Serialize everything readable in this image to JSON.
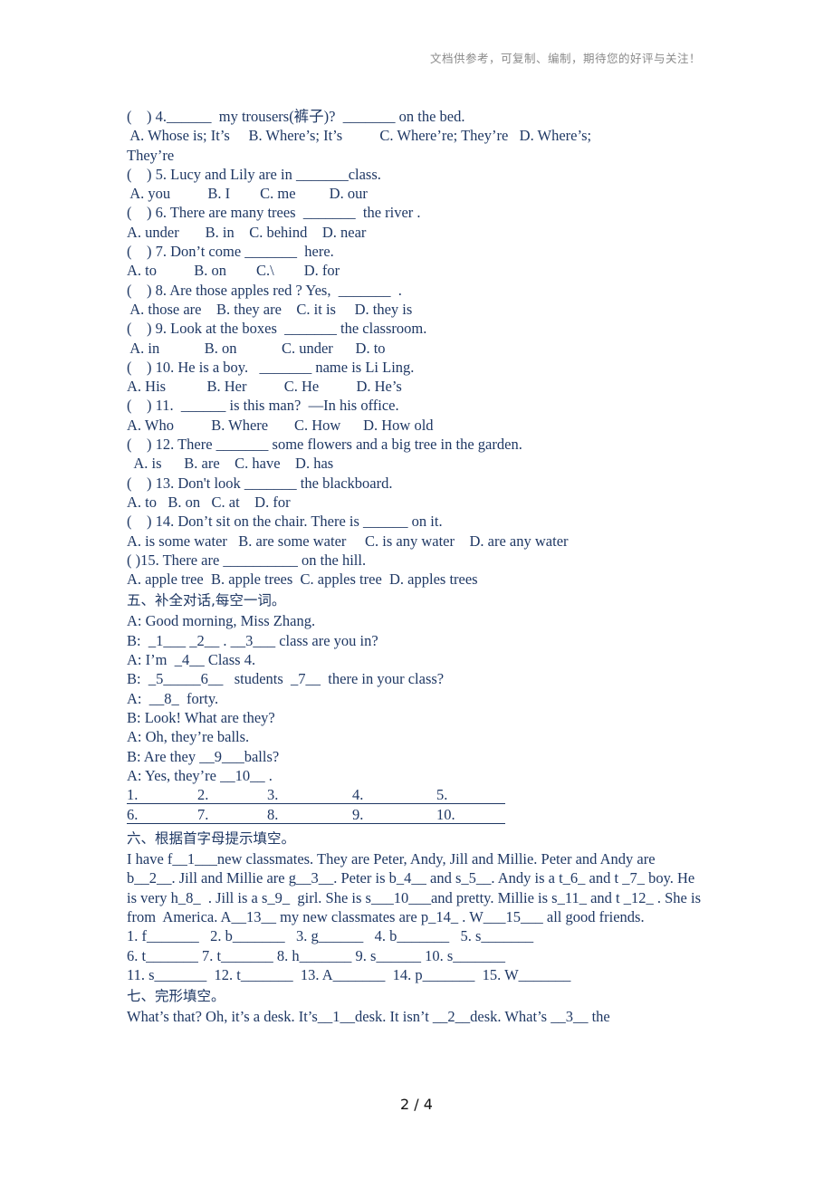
{
  "header_note": "文档供参考，可复制、编制，期待您的好评与关注！",
  "section4_questions": {
    "q4": {
      "stem": "(    ) 4.______  my trousers(裤子)?  _______ on the bed.",
      "options": " A. Whose is; It’s     B. Where’s; It’s          C. Where’re; They’re   D. Where’s;",
      "options_cont": "They’re"
    },
    "q5": {
      "stem": "(    ) 5. Lucy and Lily are in _______class.",
      "options": " A. you          B. I        C. me         D. our"
    },
    "q6": {
      "stem": "(    ) 6. There are many trees  _______  the river .",
      "options": "A. under       B. in    C. behind    D. near"
    },
    "q7": {
      "stem": "(    ) 7. Don’t come _______  here.",
      "options": "A. to          B. on        C.\\        D. for"
    },
    "q8": {
      "stem": "(    ) 8. Are those apples red ? Yes,  _______  .",
      "options": " A. those are    B. they are    C. it is     D. they is"
    },
    "q9": {
      "stem": "(    ) 9. Look at the boxes  _______ the classroom.",
      "options": " A. in            B. on            C. under      D. to"
    },
    "q10": {
      "stem": "(    ) 10. He is a boy.   _______ name is Li Ling.",
      "options": "A. His           B. Her          C. He          D. He’s"
    },
    "q11": {
      "stem": "(    ) 11.  ______ is this man?  —In his office.",
      "options": "A. Who          B. Where       C. How      D. How old"
    },
    "q12": {
      "stem": "(    ) 12. There _______ some flowers and a big tree in the garden.",
      "options": "  A. is      B. are    C. have    D. has"
    },
    "q13": {
      "stem": "(    ) 13. Don't look _______ the blackboard.",
      "options": "A. to   B. on   C. at    D. for"
    },
    "q14": {
      "stem": "(    ) 14. Don’t sit on the chair. There is ______ on it.",
      "options": "A. is some water   B. are some water     C. is any water    D. are any water"
    },
    "q15": {
      "stem": "( )15. There are __________ on the hill.",
      "options": "A. apple tree  B. apple trees  C. apples tree  D. apples trees"
    }
  },
  "section5": {
    "heading": "五、补全对话,每空一词。",
    "dialogue": [
      "A: Good morning, Miss Zhang.",
      "B:  _1___ _2__ . __3___ class are you in?",
      "A: I’m  _4__ Class 4.",
      "B:  _5_____6__   students  _7__  there in your class?",
      "A:  __8_  forty.",
      "B: Look! What are they?",
      "A: Oh, they’re balls.",
      "B: Are they __9___balls?",
      "A: Yes, they’re __10__ ."
    ],
    "answer_rows": [
      [
        "1.",
        "2.",
        "3.",
        "4.",
        "5."
      ],
      [
        "6.",
        "7.",
        "8.",
        "9.",
        "10."
      ]
    ]
  },
  "section6": {
    "heading": "六、根据首字母提示填空。",
    "passage": "I have f__1___new classmates. They are Peter, Andy, Jill and Millie. Peter and Andy are b__2__. Jill and Millie are g__3__. Peter is b_4__ and s_5__. Andy is a t_6_ and t _7_ boy. He is very h_8_  . Jill is a s_9_  girl. She is s___10___and pretty. Millie is s_11_ and t _12_ . She is from  America. A__13__ my new classmates are p_14_ . W___15___ all good friends.",
    "answer_lines": [
      "1. f_______   2. b_______   3. g______   4. b_______   5. s_______",
      "6. t_______ 7. t_______ 8. h_______ 9. s______ 10. s_______",
      "11. s_______  12. t_______  13. A_______  14. p_______  15. W_______"
    ]
  },
  "section7": {
    "heading": "七、完形填空。",
    "passage_start": "What’s that? Oh, it’s a desk. It’s__1__desk. It isn’t __2__desk. What’s __3__ the"
  },
  "page_number": "2 / 4"
}
